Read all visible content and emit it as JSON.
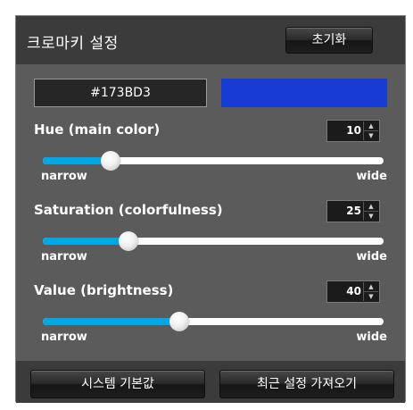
{
  "panel": {
    "title": "크로마키 설정",
    "reset_label": "초기화"
  },
  "color": {
    "hex": "#173BD3",
    "swatch": "#173BD3"
  },
  "hue": {
    "label": "Hue (main color)",
    "value": "10",
    "min_label": "narrow",
    "max_label": "wide",
    "fraction": 0.2
  },
  "saturation": {
    "label": "Saturation (colorfulness)",
    "value": "25",
    "min_label": "narrow",
    "max_label": "wide",
    "fraction": 0.25
  },
  "brightness": {
    "label": "Value (brightness)",
    "value": "40",
    "min_label": "narrow",
    "max_label": "wide",
    "fraction": 0.4
  },
  "footer": {
    "system_default_label": "시스템 기본값",
    "recent_settings_label": "최근 설정 가져오기"
  },
  "icons": {
    "spin_up": "▲",
    "spin_down": "▼"
  },
  "colors": {
    "accent": "#00A9E6",
    "panel_bg": "#5B5B5B",
    "header_bg": "#3B3B3B"
  }
}
